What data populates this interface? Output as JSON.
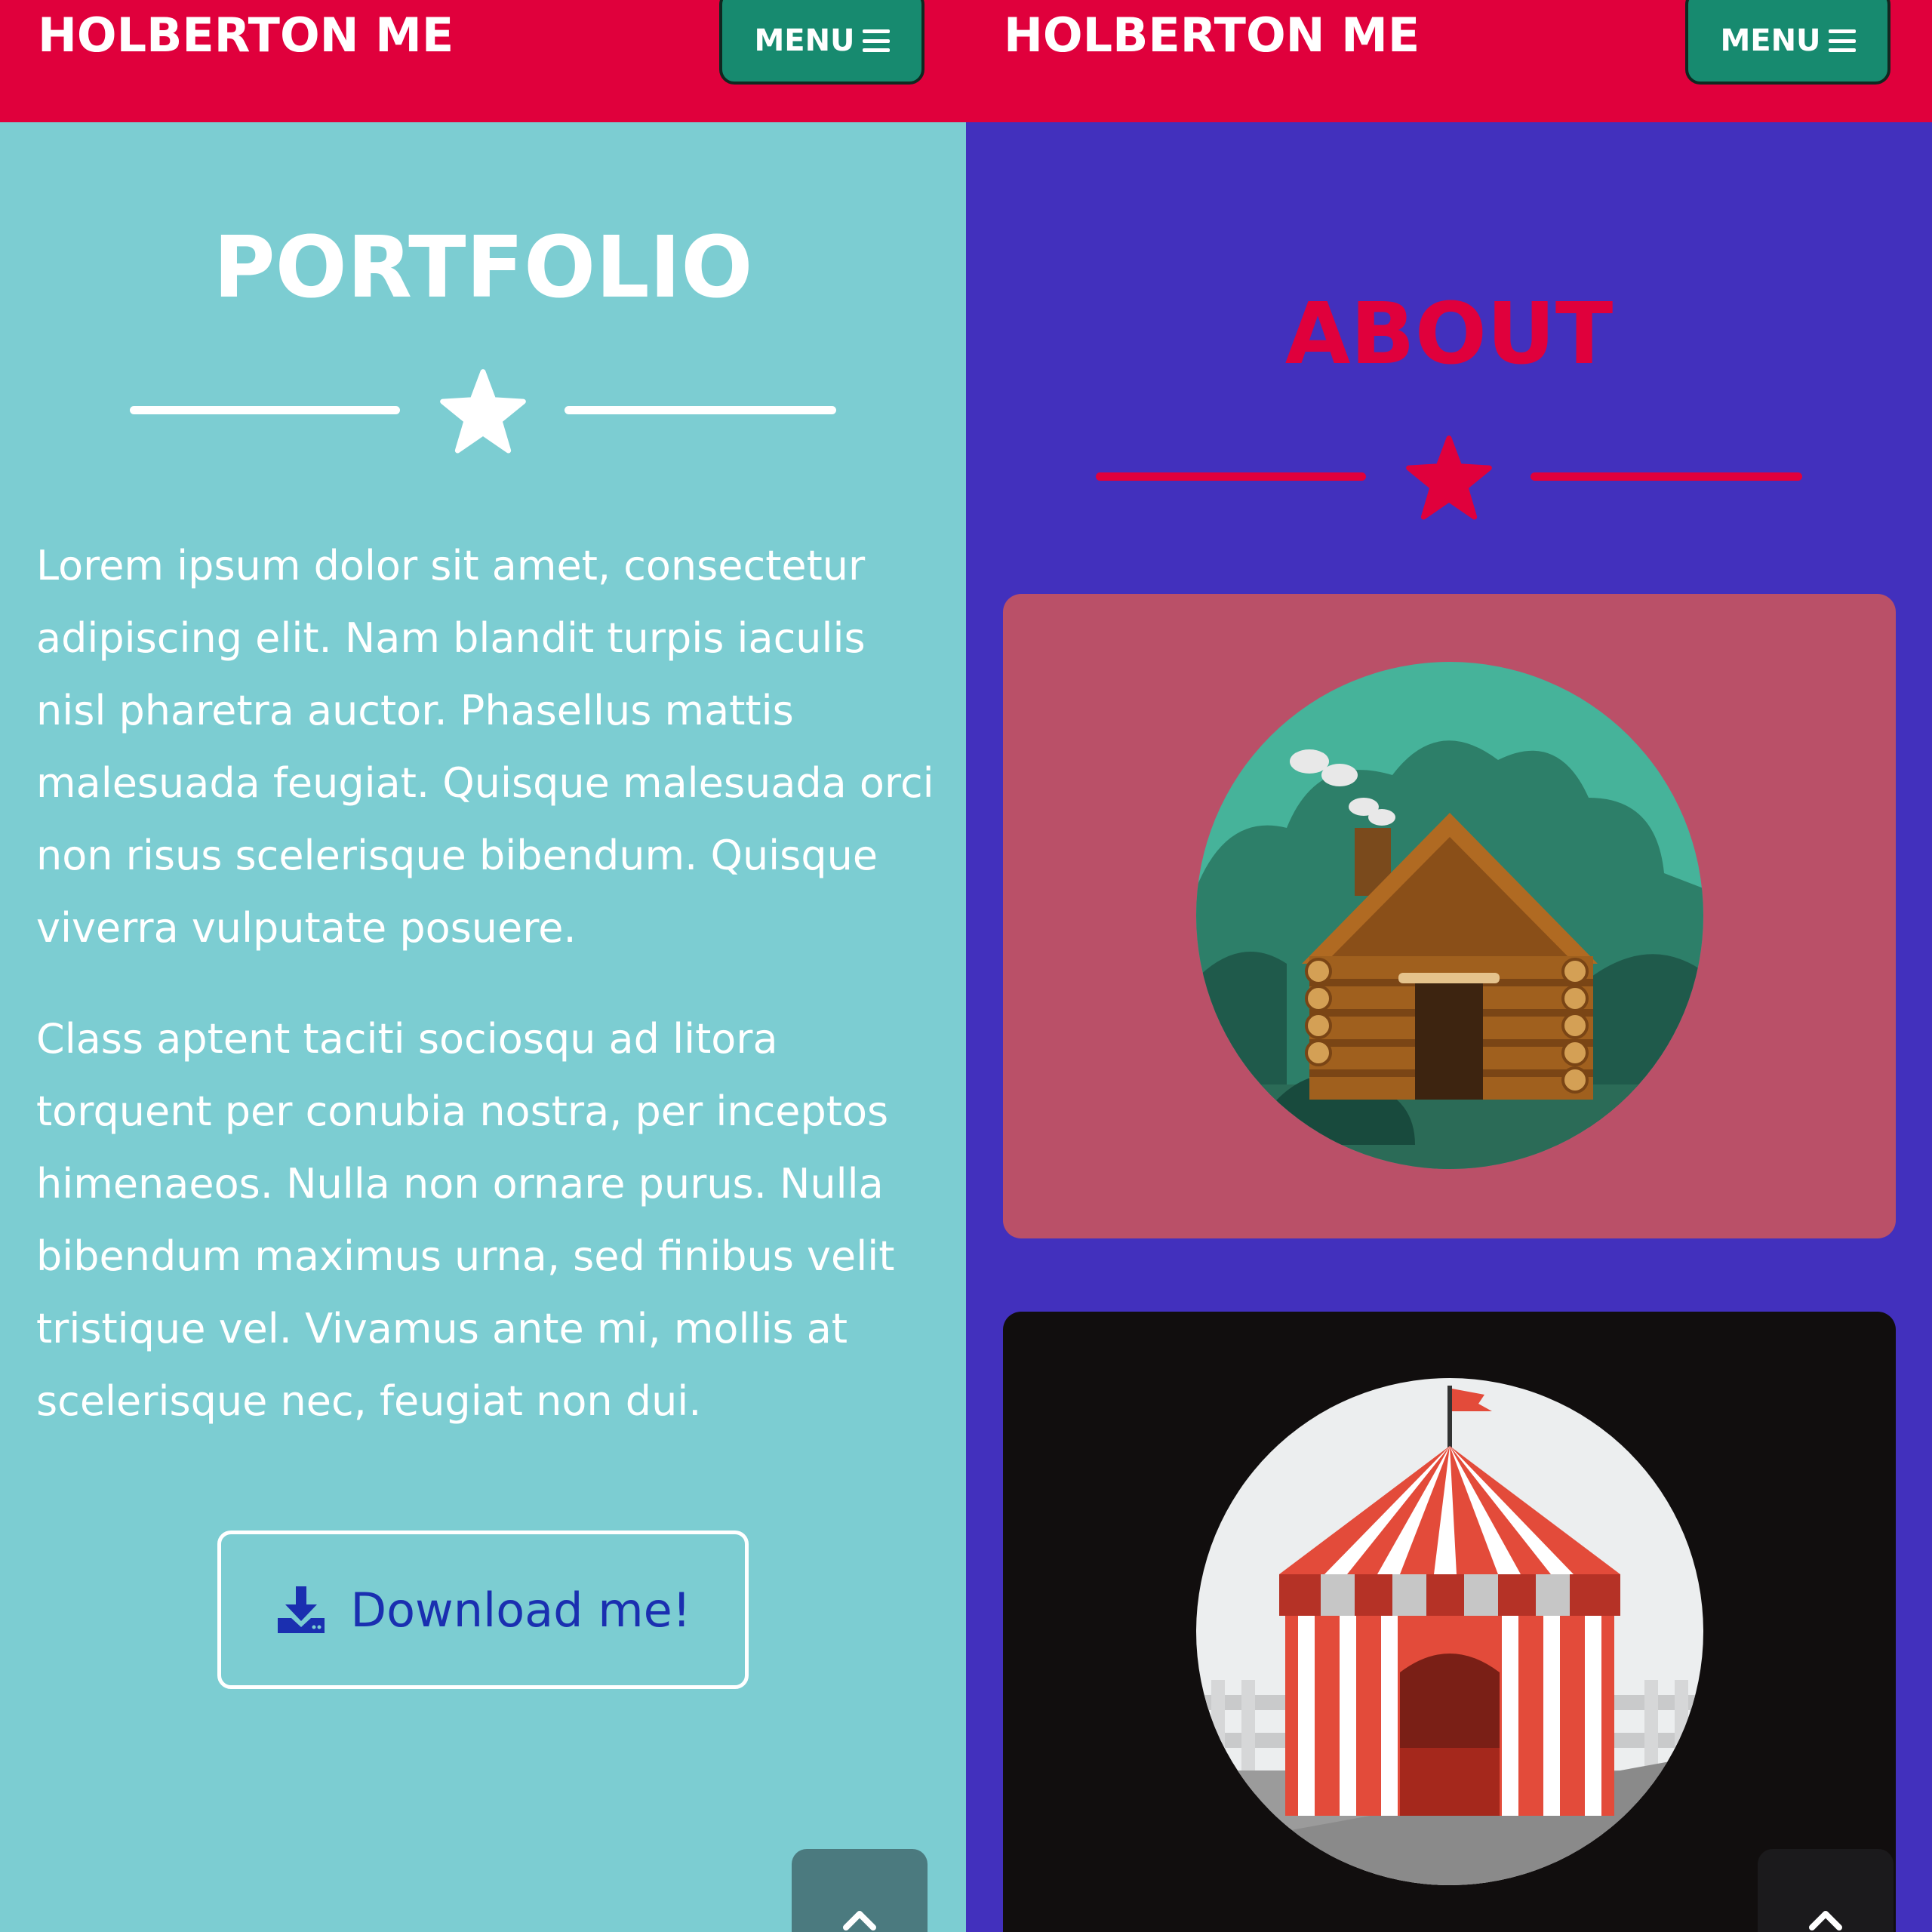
{
  "left": {
    "header": {
      "brand": "HOLBERTON ME",
      "menu_label": "MENU"
    },
    "section": {
      "title": "PORTFOLIO",
      "paragraphs": [
        "Lorem ipsum dolor sit amet, consectetur adipiscing elit. Nam blandit turpis iaculis nisl pharetra auctor. Phasellus mattis malesuada feugiat. Quisque malesuada orci non risus scelerisque bibendum. Quisque viverra vulputate posuere.",
        "Class aptent taciti sociosqu ad litora torquent per conubia nostra, per inceptos himenaeos. Nulla non ornare purus. Nulla bibendum maximus urna, sed finibus velit tristique vel. Vivamus ante mi, mollis at scelerisque nec, feugiat non dui."
      ],
      "download_label": "Download me!"
    },
    "icons": {
      "star": "star-icon",
      "download": "download-icon",
      "menu": "hamburger-icon",
      "scroll_top": "chevron-up-icon"
    }
  },
  "right": {
    "header": {
      "brand": "HOLBERTON ME",
      "menu_label": "MENU"
    },
    "section": {
      "title": "ABOUT"
    },
    "cards": [
      {
        "image": "log-cabin-illustration",
        "background": "#ba5068"
      },
      {
        "image": "circus-tent-illustration",
        "background": "#110e0e"
      }
    ]
  },
  "colors": {
    "header_red": "#e0003c",
    "menu_green": "#178a6f",
    "teal_background": "#7ccdd2",
    "purple_background": "#4230bd",
    "download_text": "#1a2fb0"
  }
}
